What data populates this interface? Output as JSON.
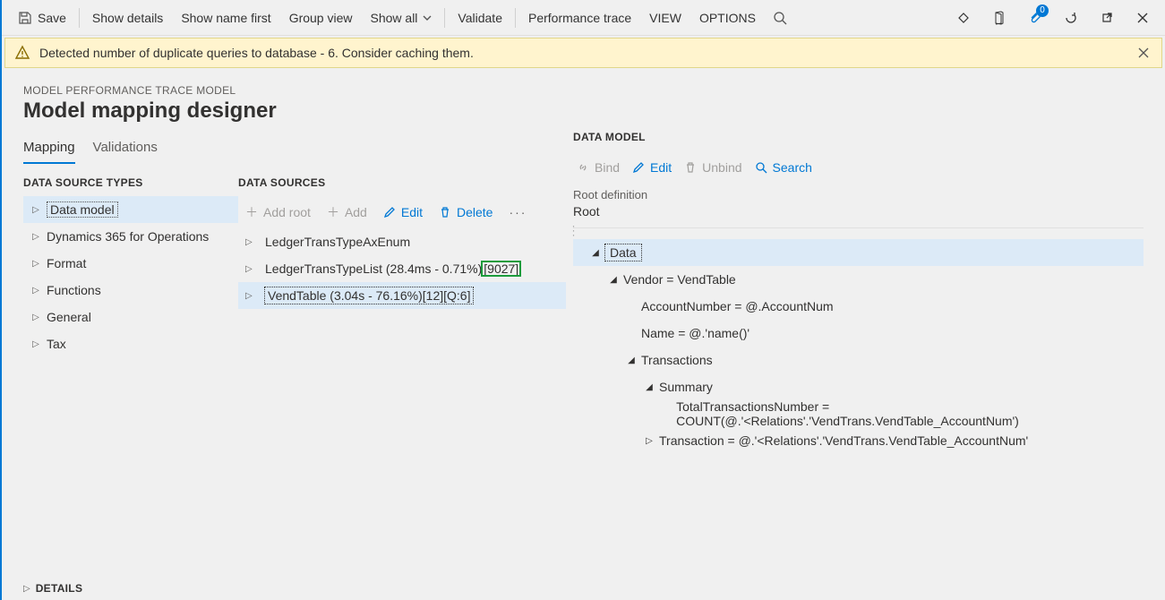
{
  "toolbar": {
    "save": "Save",
    "show_details": "Show details",
    "show_name_first": "Show name first",
    "group_view": "Group view",
    "show_all": "Show all",
    "validate": "Validate",
    "perf_trace": "Performance trace",
    "view": "VIEW",
    "options": "OPTIONS",
    "badge_count": "0"
  },
  "warning": {
    "text": "Detected number of duplicate queries to database - 6. Consider caching them."
  },
  "header": {
    "crumb": "MODEL PERFORMANCE TRACE MODEL",
    "title": "Model mapping designer"
  },
  "tabs": {
    "mapping": "Mapping",
    "validations": "Validations"
  },
  "columns": {
    "types_title": "DATA SOURCE TYPES",
    "sources_title": "DATA SOURCES"
  },
  "types": [
    "Data model",
    "Dynamics 365 for Operations",
    "Format",
    "Functions",
    "General",
    "Tax"
  ],
  "ds_toolbar": {
    "add_root": "Add root",
    "add": "Add",
    "edit": "Edit",
    "delete": "Delete"
  },
  "data_sources": {
    "item1": "LedgerTransTypeAxEnum",
    "item2_main": "LedgerTransTypeList (28.4ms - 0.71%)",
    "item2_badge": "[9027]",
    "item3": "VendTable (3.04s - 76.16%)[12][Q:6]"
  },
  "right": {
    "heading": "DATA MODEL",
    "bind": "Bind",
    "edit": "Edit",
    "unbind": "Unbind",
    "search": "Search",
    "root_label": "Root definition",
    "root_value": "Root"
  },
  "dm": {
    "data": "Data",
    "vendor": "Vendor = VendTable",
    "account": "AccountNumber = @.AccountNum",
    "name": "Name = @.'name()'",
    "transactions": "Transactions",
    "summary": "Summary",
    "total": "TotalTransactionsNumber = COUNT(@.'<Relations'.'VendTrans.VendTable_AccountNum')",
    "transaction": "Transaction = @.'<Relations'.'VendTrans.VendTable_AccountNum'"
  },
  "details": {
    "label": "DETAILS"
  }
}
